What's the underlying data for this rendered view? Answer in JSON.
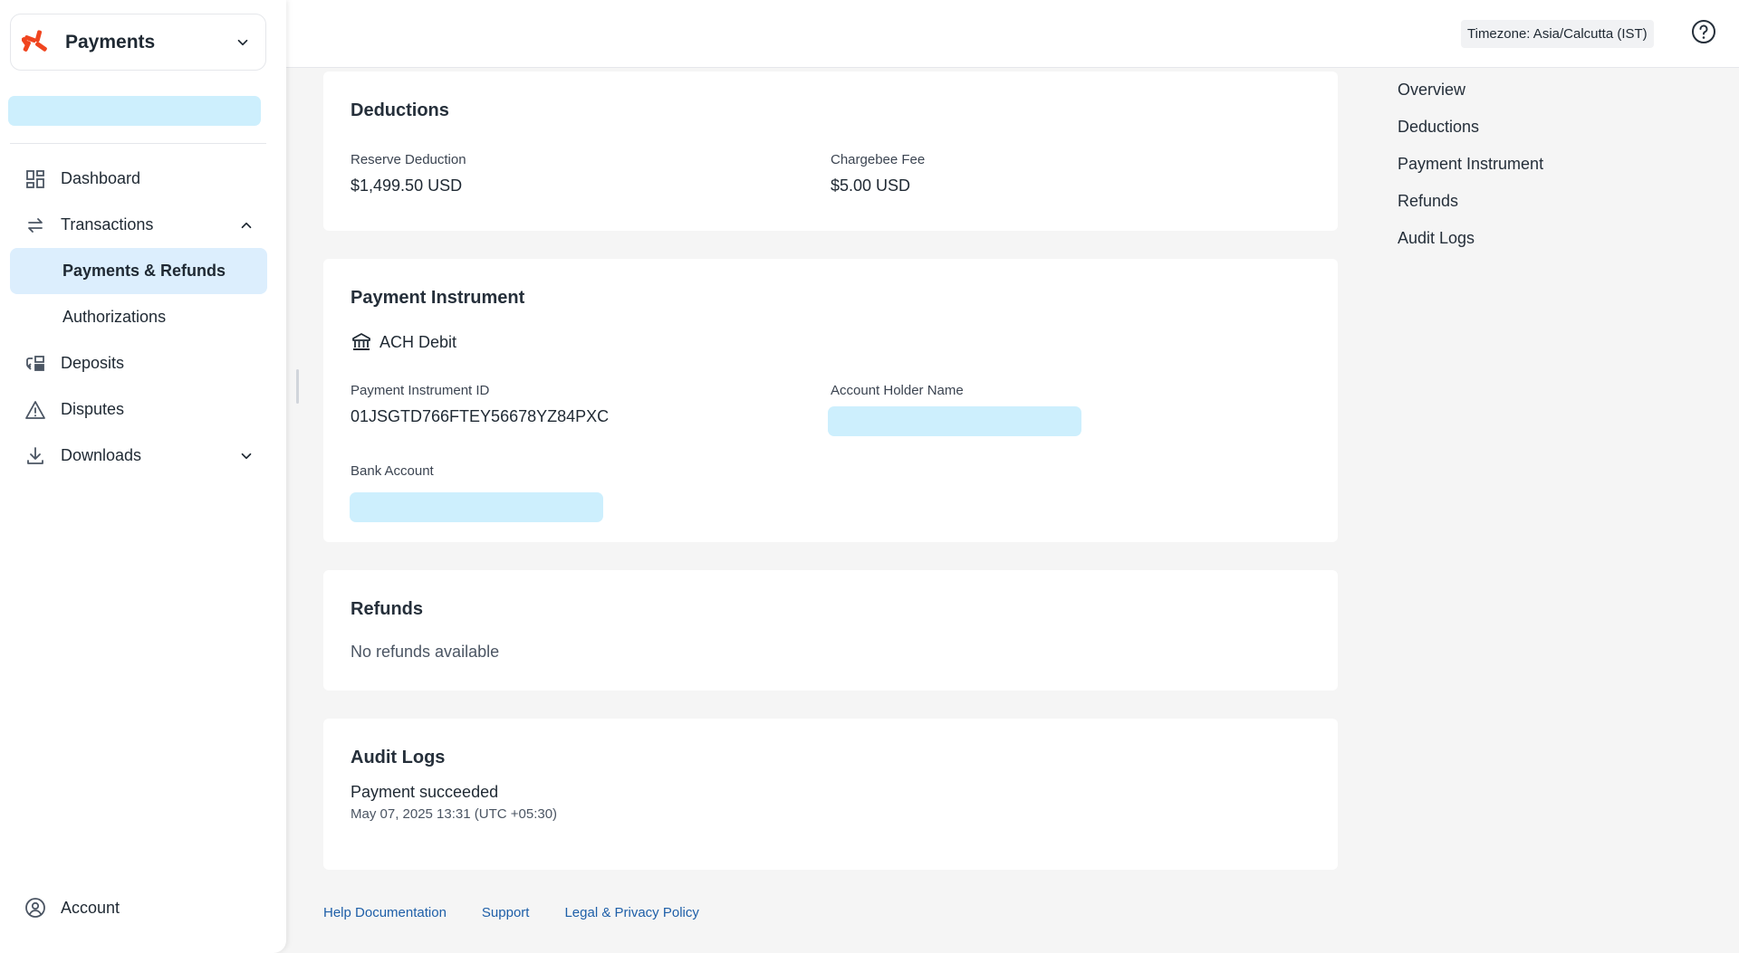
{
  "app": {
    "name": "Payments"
  },
  "sidebar": {
    "items": [
      {
        "label": "Dashboard",
        "icon": "dashboard-icon"
      },
      {
        "label": "Transactions",
        "icon": "transfer-arrows-icon",
        "expanded": true,
        "children": [
          {
            "label": "Payments & Refunds",
            "active": true
          },
          {
            "label": "Authorizations",
            "active": false
          }
        ]
      },
      {
        "label": "Deposits",
        "icon": "deposits-icon"
      },
      {
        "label": "Disputes",
        "icon": "warning-triangle-icon"
      },
      {
        "label": "Downloads",
        "icon": "download-icon",
        "expanded": false
      }
    ],
    "account_label": "Account"
  },
  "topbar": {
    "timezone": "Timezone: Asia/Calcutta (IST)"
  },
  "deductions": {
    "title": "Deductions",
    "reserve_label": "Reserve Deduction",
    "reserve_value": "$1,499.50 USD",
    "fee_label": "Chargebee Fee",
    "fee_value": "$5.00 USD"
  },
  "instrument": {
    "title": "Payment Instrument",
    "type": "ACH Debit",
    "id_label": "Payment Instrument ID",
    "id_value": "01JSGTD766FTEY56678YZ84PXC",
    "holder_label": "Account Holder Name",
    "bank_label": "Bank Account"
  },
  "refunds": {
    "title": "Refunds",
    "empty": "No refunds available"
  },
  "audit": {
    "title": "Audit Logs",
    "entry": "Payment succeeded",
    "timestamp": "May 07, 2025 13:31 (UTC +05:30)"
  },
  "toc": [
    "Overview",
    "Deductions",
    "Payment Instrument",
    "Refunds",
    "Audit Logs"
  ],
  "footer": [
    "Help Documentation",
    "Support",
    "Legal & Privacy Policy"
  ],
  "colors": {
    "accent": "#1e5fa8",
    "active_bg": "#dceefd",
    "redacted": "#cdeffd",
    "logo": "#f0451f"
  }
}
